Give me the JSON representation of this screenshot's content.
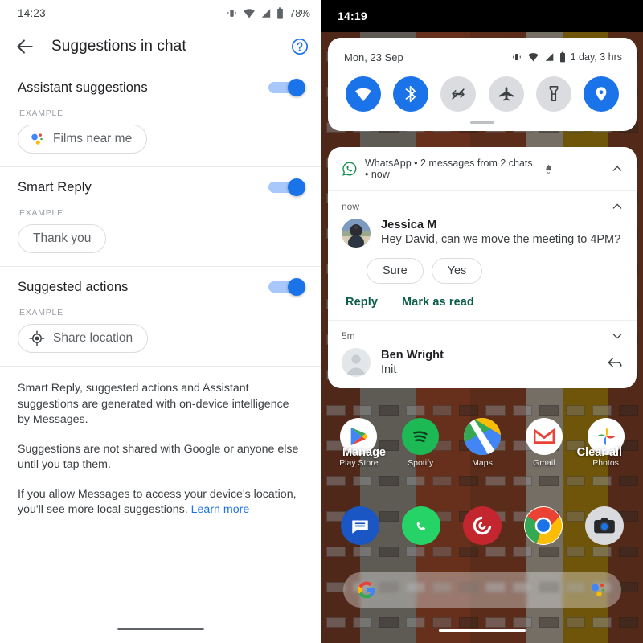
{
  "left": {
    "status_bar": {
      "time": "14:23",
      "battery_percent": "78%",
      "icons": [
        "vibrate-icon",
        "wifi-icon",
        "signal-icon",
        "battery-icon"
      ]
    },
    "app_bar": {
      "back_icon": "back-arrow-icon",
      "title": "Suggestions in chat",
      "help_icon": "help-circle-icon"
    },
    "settings": [
      {
        "label": "Assistant suggestions",
        "toggle_on": true,
        "example_caption": "EXAMPLE",
        "chip": {
          "text": "Films near me",
          "icon": "google-assistant-icon"
        }
      },
      {
        "label": "Smart Reply",
        "toggle_on": true,
        "example_caption": "EXAMPLE",
        "chip": {
          "text": "Thank you",
          "icon": "none"
        }
      },
      {
        "label": "Suggested actions",
        "toggle_on": true,
        "example_caption": "EXAMPLE",
        "chip": {
          "text": "Share location",
          "icon": "my-location-icon"
        }
      }
    ],
    "info": {
      "p1": "Smart Reply, suggested actions and Assistant suggestions are generated with on-device intelligence by Messages.",
      "p2": "Suggestions are not shared with Google or anyone else until you tap them.",
      "p3": "If you allow Messages to access your device's location, you'll see more local suggestions.",
      "link": "Learn more"
    }
  },
  "right": {
    "status_bar": {
      "time": "14:19"
    },
    "quick_settings": {
      "date": "Mon, 23 Sep",
      "battery_text": "1 day, 3 hrs",
      "status_icons": [
        "vibrate-icon",
        "wifi-icon",
        "signal-icon",
        "battery-icon"
      ],
      "tiles": [
        {
          "name": "wifi-tile",
          "icon": "wifi-icon",
          "on": true
        },
        {
          "name": "bluetooth-tile",
          "icon": "bluetooth-icon",
          "on": true
        },
        {
          "name": "auto-rotate-tile",
          "icon": "auto-rotate-icon",
          "on": false
        },
        {
          "name": "airplane-mode-tile",
          "icon": "airplane-icon",
          "on": false
        },
        {
          "name": "flashlight-tile",
          "icon": "flashlight-icon",
          "on": false
        },
        {
          "name": "location-tile",
          "icon": "location-pin-icon",
          "on": true
        }
      ]
    },
    "notification": {
      "app_icon": "whatsapp-icon",
      "header": "WhatsApp • 2 messages from 2 chats • now",
      "header_badge_icon": "silent-bell-icon",
      "collapse_icon": "chevron-up-icon",
      "groups": [
        {
          "time": "now",
          "expanded": true,
          "sender": "Jessica M",
          "message": "Hey David, can we move the meeting to 4PM?",
          "avatar": "photo-avatar",
          "reply_chips": [
            "Sure",
            "Yes"
          ],
          "actions": [
            "Reply",
            "Mark as read"
          ]
        },
        {
          "time": "5m",
          "expanded": false,
          "sender": "Ben Wright",
          "message": "Init",
          "avatar": "person-placeholder-avatar",
          "trailing_icon": "reply-arrow-icon"
        }
      ]
    },
    "footer": {
      "manage": "Manage",
      "clear_all": "Clear all"
    },
    "home_screen": {
      "apps": [
        {
          "name": "Play Store",
          "icon": "play-store-icon"
        },
        {
          "name": "Spotify",
          "icon": "spotify-icon"
        },
        {
          "name": "Maps",
          "icon": "maps-icon"
        },
        {
          "name": "Gmail",
          "icon": "gmail-icon"
        },
        {
          "name": "Photos",
          "icon": "photos-icon"
        }
      ],
      "dock": [
        {
          "name": "Messages",
          "icon": "messages-icon"
        },
        {
          "name": "WhatsApp",
          "icon": "whatsapp-icon"
        },
        {
          "name": "Pocket Casts",
          "icon": "pocket-casts-icon"
        },
        {
          "name": "Chrome",
          "icon": "chrome-icon"
        },
        {
          "name": "Camera",
          "icon": "camera-icon"
        }
      ],
      "search_bar": {
        "left_icon": "google-g-icon",
        "right_icon": "google-assistant-icon"
      }
    }
  },
  "colors": {
    "accent_blue": "#1a73e8",
    "track_blue": "#a8c7fa",
    "action_green": "#0b5c4b",
    "link_blue": "#1a73e8"
  }
}
